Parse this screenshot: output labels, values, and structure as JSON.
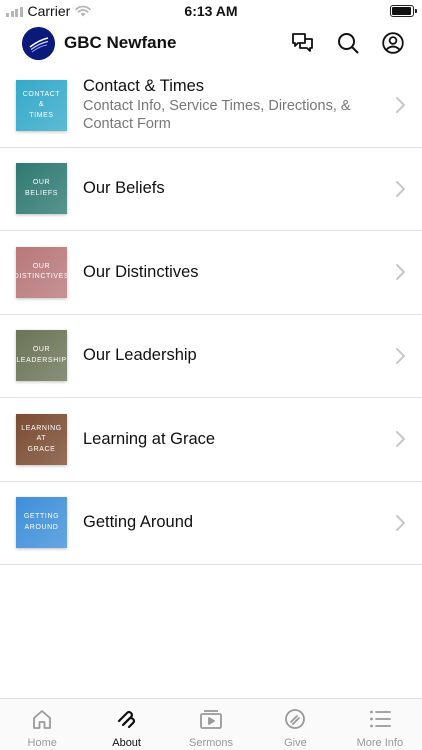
{
  "status_bar": {
    "carrier": "Carrier",
    "time": "6:13 AM",
    "battery_level": 0.95
  },
  "header": {
    "title": "GBC Newfane",
    "logo_icon": "church-logo-icon",
    "actions": [
      {
        "name": "chat-icon"
      },
      {
        "name": "search-icon"
      },
      {
        "name": "profile-icon"
      }
    ]
  },
  "menu": {
    "items": [
      {
        "thumb_text": "CONTACT\n&\nTIMES",
        "thumb_color": "#35a9c9",
        "title": "Contact & Times",
        "subtitle": "Contact Info, Service Times, Directions, & Contact Form"
      },
      {
        "thumb_text": "OUR\nBELIEFS",
        "thumb_color": "#2f7a72",
        "title": "Our Beliefs",
        "subtitle": ""
      },
      {
        "thumb_text": "OUR\nDISTINCTIVES",
        "thumb_color": "#b8787a",
        "title": "Our Distinctives",
        "subtitle": ""
      },
      {
        "thumb_text": "OUR\nLEADERSHIP",
        "thumb_color": "#6b7458",
        "title": "Our Leadership",
        "subtitle": ""
      },
      {
        "thumb_text": "LEARNING\nAT\nGRACE",
        "thumb_color": "#7a4c32",
        "title": "Learning at Grace",
        "subtitle": ""
      },
      {
        "thumb_text": "GETTING\nAROUND",
        "thumb_color": "#3f8fd9",
        "title": "Getting Around",
        "subtitle": ""
      }
    ]
  },
  "tabbar": {
    "tabs": [
      {
        "label": "Home",
        "icon": "home-icon",
        "active": false
      },
      {
        "label": "About",
        "icon": "about-icon",
        "active": true
      },
      {
        "label": "Sermons",
        "icon": "video-icon",
        "active": false
      },
      {
        "label": "Give",
        "icon": "give-icon",
        "active": false
      },
      {
        "label": "More Info",
        "icon": "list-icon",
        "active": false
      }
    ]
  }
}
